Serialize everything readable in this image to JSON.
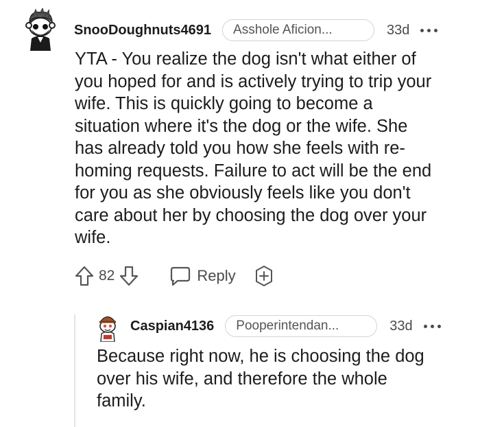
{
  "comments": [
    {
      "username": "SnooDoughnuts4691",
      "flair": "Asshole Aficion...",
      "time": "33d",
      "body": "YTA - You realize the dog isn't what either of\nyou hoped for and is actively trying to trip your\nwife. This is quickly going to become a\nsituation where it's the dog or the wife. She\nhas already told you how she feels with re-\nhoming requests. Failure to act will be the end\nfor you as she obviously feels like you don't\ncare about her by choosing the dog over your\nwife.",
      "votes": "82",
      "reply_label": "Reply",
      "avatar_icon": "snoo-avatar-icon"
    },
    {
      "username": "Caspian4136",
      "flair": "Pooperintendan...",
      "time": "33d",
      "body": "Because right now, he is choosing the dog\nover his wife, and therefore the whole\nfamily.",
      "avatar_icon": "snoo-avatar-icon"
    }
  ],
  "icons": {
    "upvote": "upvote-arrow-icon",
    "downvote": "downvote-arrow-icon",
    "reply": "speech-bubble-icon",
    "award": "award-plus-icon",
    "more": "more-dots-icon"
  }
}
